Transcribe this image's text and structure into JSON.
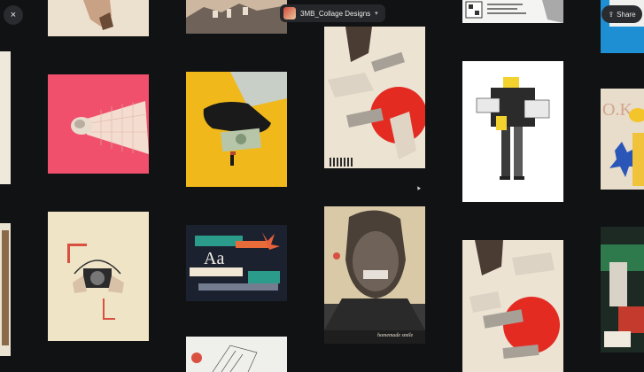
{
  "toolbar": {
    "close_glyph": "×",
    "board_name": "3MB_Collage Designs",
    "board_chevron": "▾",
    "share_glyph": "⇪",
    "share_label": "Share"
  },
  "cursor": "▲",
  "artwork_captions": {
    "poster_face": "homemade smile",
    "headline_letters": "Aa",
    "fashion_letters": "O.K."
  },
  "icons": {
    "close": "close-icon",
    "board_thumb": "board-thumbnail",
    "chevron": "chevron-down-icon",
    "share": "share-icon"
  }
}
